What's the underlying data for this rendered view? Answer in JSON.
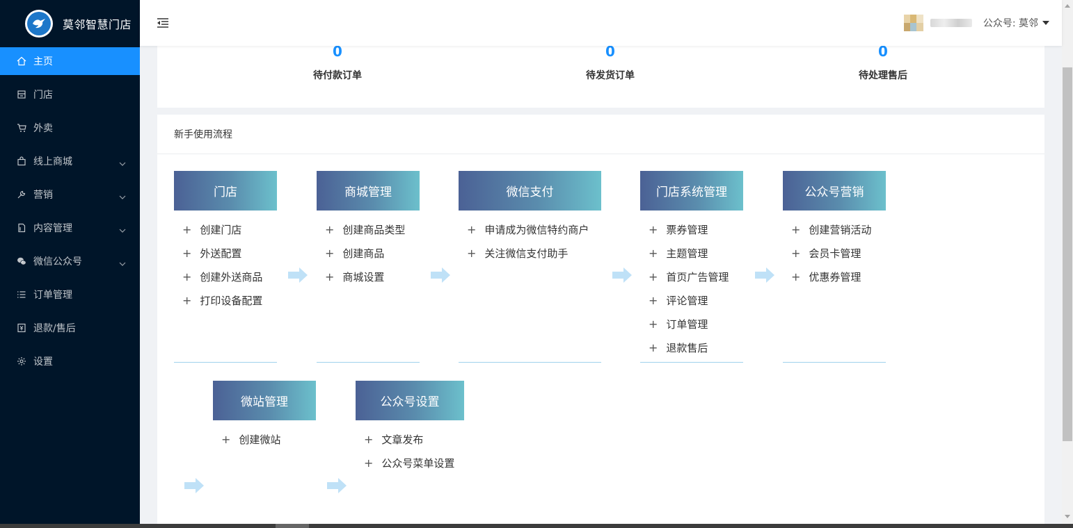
{
  "app": {
    "title": "莫邻智慧门店"
  },
  "sidebar": {
    "items": [
      {
        "label": "主页",
        "icon": "home-icon",
        "active": true,
        "expandable": false
      },
      {
        "label": "门店",
        "icon": "store-icon",
        "active": false,
        "expandable": false
      },
      {
        "label": "外卖",
        "icon": "cart-icon",
        "active": false,
        "expandable": false
      },
      {
        "label": "线上商城",
        "icon": "shopping-bag-icon",
        "active": false,
        "expandable": true
      },
      {
        "label": "营销",
        "icon": "wrench-icon",
        "active": false,
        "expandable": true
      },
      {
        "label": "内容管理",
        "icon": "document-icon",
        "active": false,
        "expandable": true
      },
      {
        "label": "微信公众号",
        "icon": "wechat-icon",
        "active": false,
        "expandable": true
      },
      {
        "label": "订单管理",
        "icon": "list-icon",
        "active": false,
        "expandable": false
      },
      {
        "label": "退款/售后",
        "icon": "refund-icon",
        "active": false,
        "expandable": false
      },
      {
        "label": "设置",
        "icon": "gear-icon",
        "active": false,
        "expandable": false
      }
    ]
  },
  "header": {
    "account": "公众号: 莫邻"
  },
  "stats": [
    {
      "value": "0",
      "label": "待付款订单"
    },
    {
      "value": "0",
      "label": "待发货订单"
    },
    {
      "value": "0",
      "label": "待处理售后"
    }
  ],
  "guide": {
    "title": "新手使用流程",
    "steps": [
      {
        "title": "门店",
        "items": [
          "创建门店",
          "外送配置",
          "创建外送商品",
          "打印设备配置"
        ]
      },
      {
        "title": "商城管理",
        "items": [
          "创建商品类型",
          "创建商品",
          "商城设置"
        ]
      },
      {
        "title": "微信支付",
        "items": [
          "申请成为微信特约商户",
          "关注微信支付助手"
        ]
      },
      {
        "title": "门店系统管理",
        "items": [
          "票券管理",
          "主题管理",
          "首页广告管理",
          "评论管理",
          "订单管理",
          "退款售后"
        ]
      },
      {
        "title": "公众号营销",
        "items": [
          "创建营销活动",
          "会员卡管理",
          "优惠券管理"
        ]
      },
      {
        "title": "微站管理",
        "items": [
          "创建微站"
        ]
      },
      {
        "title": "公众号设置",
        "items": [
          "文章发布",
          "公众号菜单设置"
        ]
      }
    ]
  },
  "colors": {
    "primary": "#1890ff",
    "sidebar_bg": "#001529",
    "arrow": "#bfe1f7"
  }
}
